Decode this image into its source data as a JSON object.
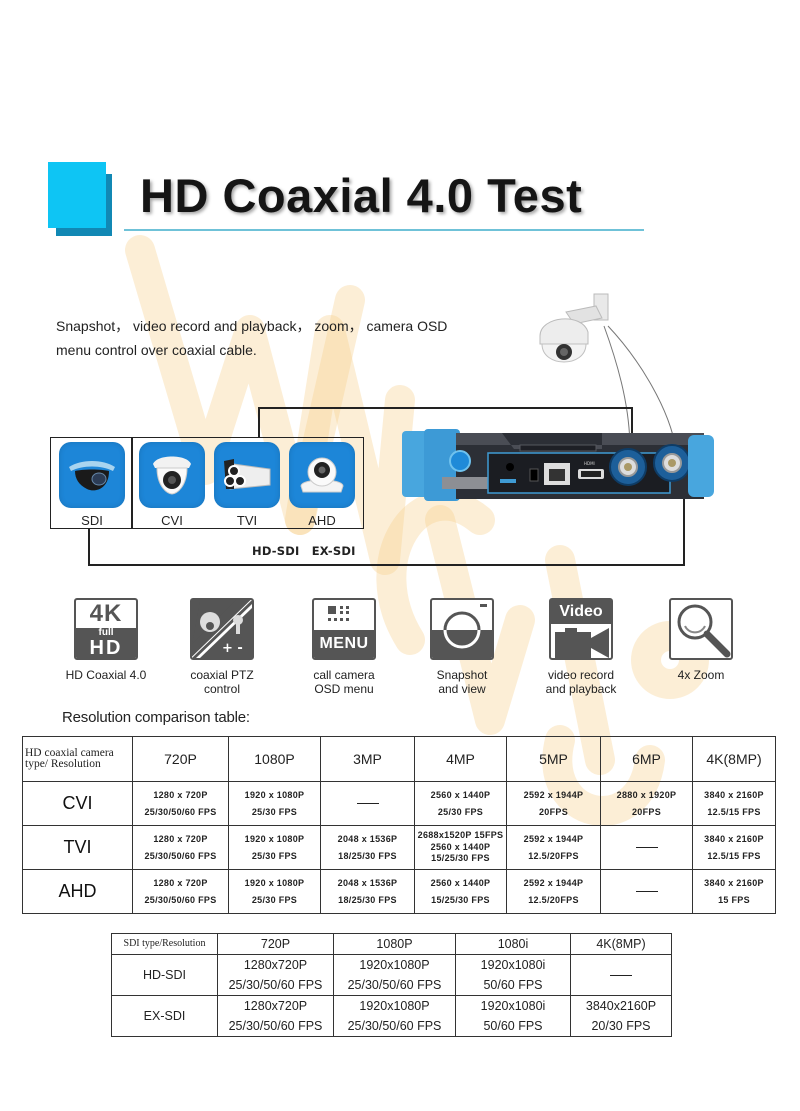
{
  "header": {
    "title": "HD Coaxial 4.0 Test"
  },
  "description": {
    "line1": "Snapshot， video record and playback， zoom， camera OSD",
    "line2": "menu control over coaxial cable."
  },
  "watermark": {
    "text": "WMCHU"
  },
  "camera_types": [
    {
      "label": "SDI",
      "icon": "speed-dome-camera-icon"
    },
    {
      "label": "CVI",
      "icon": "dome-camera-icon"
    },
    {
      "label": "TVI",
      "icon": "bullet-camera-icon"
    },
    {
      "label": "AHD",
      "icon": "turret-camera-icon"
    }
  ],
  "sdi_types": [
    "HD-SDI",
    "EX-SDI"
  ],
  "device": {
    "hdmi_label": "HDMI",
    "icon": "cctv-tester-device-icon",
    "ptz_camera_icon": "ptz-camera-icon"
  },
  "features": [
    {
      "label_line1": "HD Coaxial 4.0",
      "label_line2": "",
      "icon": "4k-full-hd-icon",
      "icon_top": "4K",
      "icon_mid": "full",
      "icon_bottom": "HD"
    },
    {
      "label_line1": "coaxial PTZ",
      "label_line2": "control",
      "icon": "ptz-joystick-icon"
    },
    {
      "label_line1": "call camera",
      "label_line2": "OSD menu",
      "icon": "menu-icon",
      "icon_text": "MENU"
    },
    {
      "label_line1": "Snapshot",
      "label_line2": "and view",
      "icon": "camera-snapshot-icon"
    },
    {
      "label_line1": "video record",
      "label_line2": "and playback",
      "icon": "video-camera-icon",
      "icon_text": "Video"
    },
    {
      "label_line1": "4x Zoom",
      "label_line2": "",
      "icon": "magnifier-icon"
    }
  ],
  "resolution_table": {
    "title": "Resolution comparison table:",
    "corner_line1": "HD coaxial camera",
    "corner_line2": "type/ Resolution",
    "columns": [
      "720P",
      "1080P",
      "3MP",
      "4MP",
      "5MP",
      "6MP",
      "4K(8MP)"
    ],
    "rows": [
      {
        "type": "CVI",
        "cells": [
          {
            "l1": "1280 x 720P",
            "l2": "25/30/50/60 FPS"
          },
          {
            "l1": "1920 x 1080P",
            "l2": "25/30 FPS"
          },
          {
            "dash": true
          },
          {
            "l1": "2560 x 1440P",
            "l2": "25/30 FPS"
          },
          {
            "l1": "2592 x 1944P",
            "l2": "20FPS"
          },
          {
            "l1": "2880 x 1920P",
            "l2": "20FPS"
          },
          {
            "l1": "3840 x 2160P",
            "l2": "12.5/15 FPS"
          }
        ]
      },
      {
        "type": "TVI",
        "cells": [
          {
            "l1": "1280 x 720P",
            "l2": "25/30/50/60 FPS"
          },
          {
            "l1": "1920 x 1080P",
            "l2": "25/30 FPS"
          },
          {
            "l1": "2048 x 1536P",
            "l2": "18/25/30 FPS"
          },
          {
            "l1": "2688x1520P 15FPS",
            "l2": "2560 x 1440P",
            "l3": "15/25/30 FPS"
          },
          {
            "l1": "2592 x 1944P",
            "l2": "12.5/20FPS"
          },
          {
            "dash": true
          },
          {
            "l1": "3840 x 2160P",
            "l2": "12.5/15 FPS"
          }
        ]
      },
      {
        "type": "AHD",
        "cells": [
          {
            "l1": "1280 x 720P",
            "l2": "25/30/50/60 FPS"
          },
          {
            "l1": "1920 x 1080P",
            "l2": "25/30 FPS"
          },
          {
            "l1": "2048 x 1536P",
            "l2": "18/25/30 FPS"
          },
          {
            "l1": "2560 x 1440P",
            "l2": "15/25/30 FPS"
          },
          {
            "l1": "2592 x 1944P",
            "l2": "12.5/20FPS"
          },
          {
            "dash": true
          },
          {
            "l1": "3840 x 2160P",
            "l2": "15 FPS"
          }
        ]
      }
    ]
  },
  "sdi_table": {
    "corner": "SDI type/Resolution",
    "columns": [
      "720P",
      "1080P",
      "1080i",
      "4K(8MP)"
    ],
    "rows": [
      {
        "type": "HD-SDI",
        "cells": [
          {
            "l1": "1280x720P",
            "l2": "25/30/50/60 FPS"
          },
          {
            "l1": "1920x1080P",
            "l2": "25/30/50/60 FPS"
          },
          {
            "l1": "1920x1080i",
            "l2": "50/60 FPS"
          },
          {
            "dash": true
          }
        ]
      },
      {
        "type": "EX-SDI",
        "cells": [
          {
            "l1": "1280x720P",
            "l2": "25/30/50/60 FPS"
          },
          {
            "l1": "1920x1080P",
            "l2": "25/30/50/60 FPS"
          },
          {
            "l1": "1920x1080i",
            "l2": "50/60 FPS"
          },
          {
            "l1": "3840x2160P",
            "l2": "20/30 FPS"
          }
        ]
      }
    ]
  }
}
